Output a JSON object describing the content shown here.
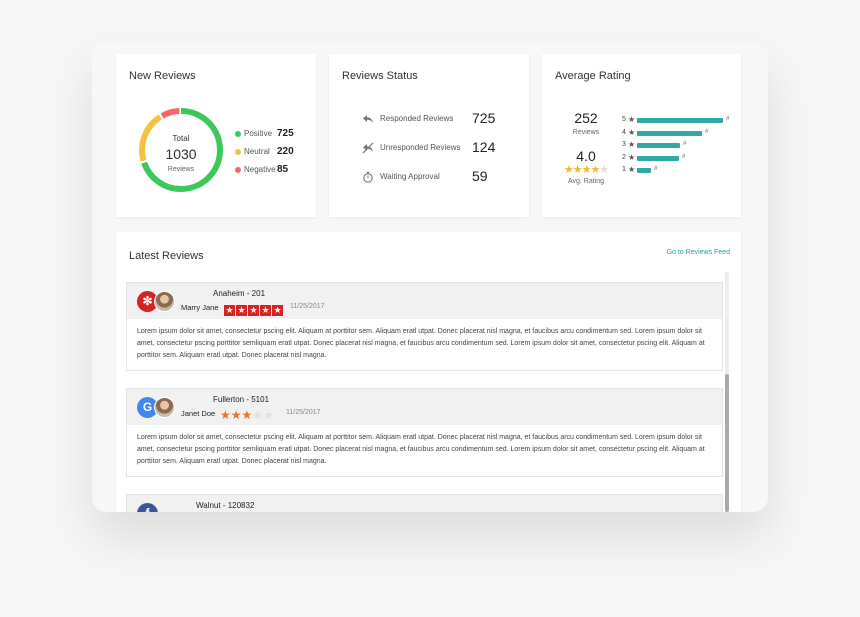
{
  "new_reviews": {
    "title": "New Reviews",
    "total_label": "Total",
    "total_value": "1030",
    "total_sub": "Reviews",
    "legend": [
      {
        "label": "Positive",
        "value": "725",
        "color": "#3cc85a"
      },
      {
        "label": "Neutral",
        "value": "220",
        "color": "#f4c23b"
      },
      {
        "label": "Negative",
        "value": "85",
        "color": "#f1676b"
      }
    ]
  },
  "reviews_status": {
    "title": "Reviews Status",
    "rows": [
      {
        "icon": "reply-icon",
        "label": "Responded Reviews",
        "value": "725"
      },
      {
        "icon": "no-reply-icon",
        "label": "Unresponded Reviews",
        "value": "124"
      },
      {
        "icon": "stopwatch-icon",
        "label": "Waiting Approval",
        "value": "59"
      }
    ]
  },
  "average_rating": {
    "title": "Average Rating",
    "count": "252",
    "count_label": "Reviews",
    "value": "4.0",
    "value_label": "Avg. Rating",
    "stars_filled": 4,
    "distribution": [
      {
        "stars": "5",
        "fraction": 0.86,
        "count": "#"
      },
      {
        "stars": "4",
        "fraction": 0.65,
        "count": "#"
      },
      {
        "stars": "3",
        "fraction": 0.43,
        "count": "#"
      },
      {
        "stars": "2",
        "fraction": 0.42,
        "count": "#"
      },
      {
        "stars": "1",
        "fraction": 0.14,
        "count": "#"
      }
    ],
    "bar_color": "#2fa9a3"
  },
  "latest_reviews": {
    "title": "Latest Reviews",
    "link": "Go to Reviews Feed",
    "items": [
      {
        "source": "yelp",
        "source_icon": "yelp-icon",
        "source_color": "#d32323",
        "source_glyph": "✻",
        "location": "Anaheim - 201",
        "reviewer": "Marry Jane",
        "rating": 5,
        "date": "11/25/2017",
        "text": "Lorem ipsum dolor sit amet, consectetur pscing elit. Aliquam at porttitor sem.  Aliquam eratl utpat. Donec placerat nisl magna, et faucibus arcu condimentum sed. Lorem ipsum dolor sit amet, consectetur pscing porttitor semliquam eratl utpat. Donec placerat nisl magna, et faucibus arcu condimentum sed. Lorem ipsum dolor sit amet, consectetur pscing elit. Aliquam at porttitor sem.  Aliquam eratl utpat. Donec placerat nisl magna."
      },
      {
        "source": "google",
        "source_icon": "google-icon",
        "source_color": "#4285f4",
        "source_glyph": "G",
        "location": "Fullerton - 5101",
        "reviewer": "Janet Doe",
        "rating": 3,
        "date": "11/25/2017",
        "text": "Lorem ipsum dolor sit amet, consectetur pscing elit. Aliquam at porttitor sem.  Aliquam eratl utpat. Donec placerat nisl magna, et faucibus arcu condimentum sed. Lorem ipsum dolor sit amet, consectetur pscing porttitor semliquam eratl utpat. Donec placerat nisl magna, et faucibus arcu condimentum sed. Lorem ipsum dolor sit amet, consectetur pscing elit. Aliquam at porttitor sem.  Aliquam eratl utpat. Donec placerat nisl magna."
      },
      {
        "source": "facebook",
        "source_icon": "facebook-icon",
        "source_color": "#3b5998",
        "source_glyph": "f",
        "location": "Walnut - 120832"
      }
    ]
  }
}
